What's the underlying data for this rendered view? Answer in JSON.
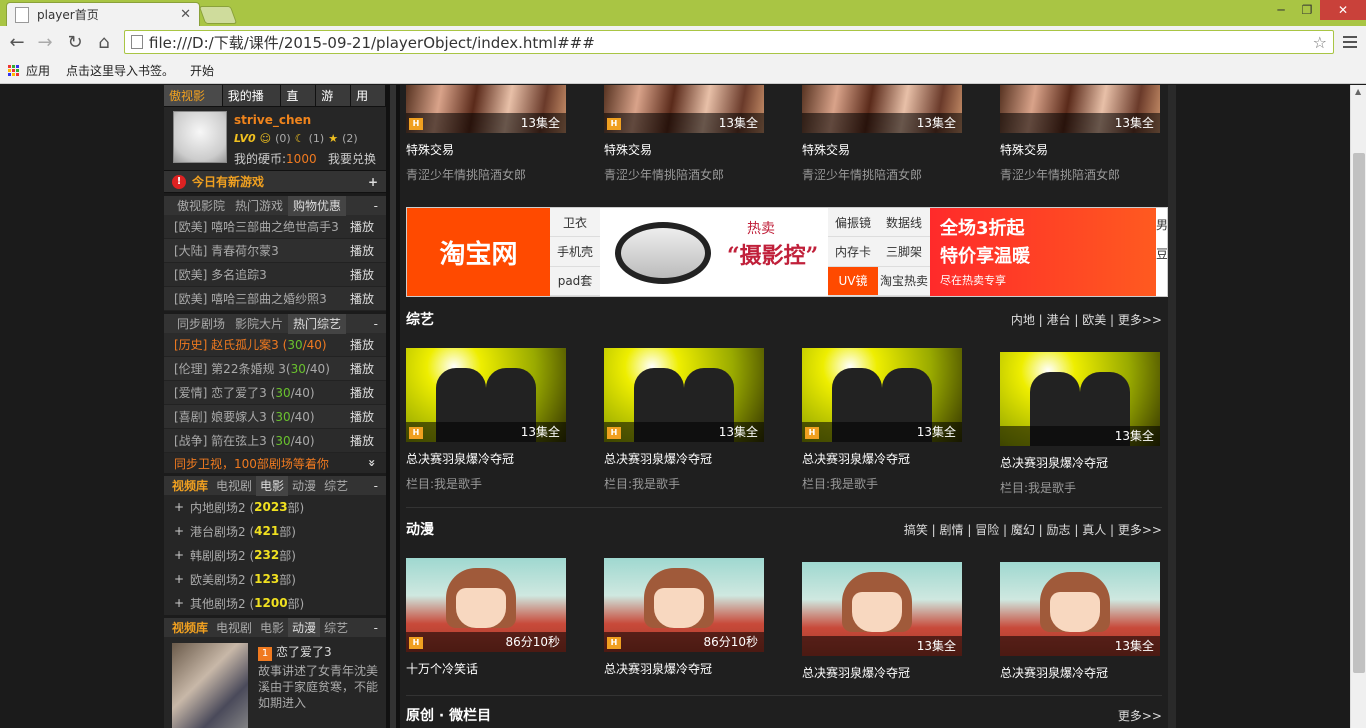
{
  "browser": {
    "tab_title": "player首页",
    "url": "file:///D:/下载/课件/2015-09-21/playerObject/index.html###",
    "bookmarks": [
      "应用",
      "点击这里导入书签。",
      "开始"
    ],
    "win_min": "─",
    "win_max": "❐",
    "win_close": "✕",
    "tab_close": "✕"
  },
  "sidebar": {
    "tabs": [
      "傲视影音",
      "我的播放",
      "直播",
      "游戏",
      "用户"
    ],
    "user": {
      "name": "strive_chen",
      "level": "LV0",
      "stat1": "(0)",
      "stat2": "(1)",
      "stat3": "(2)",
      "coin_label": "我的硬币:",
      "coin_value": "1000",
      "redeem": "我要兑换"
    },
    "newgame": {
      "label": "今日有新游戏",
      "plus": "+"
    },
    "section1": {
      "tabs": [
        "傲视影院",
        "热门游戏",
        "购物优惠"
      ],
      "minus": "-",
      "rows": [
        {
          "title": "[欧美] 嘻哈三部曲之绝世高手3",
          "play": "播放"
        },
        {
          "title": "[大陆] 青春荷尔蒙3",
          "play": "播放"
        },
        {
          "title": "[欧美] 多名追踪3",
          "play": "播放"
        },
        {
          "title": "[欧美] 嘻哈三部曲之婚纱照3",
          "play": "播放"
        }
      ]
    },
    "section2": {
      "tabs": [
        "同步剧场",
        "影院大片",
        "热门综艺"
      ],
      "minus": "-",
      "rows": [
        {
          "title": "[历史] 赵氏孤儿案3 (",
          "ep": "30",
          "total": "/40)",
          "play": "播放"
        },
        {
          "title": "[伦理] 第22条婚规 3(",
          "ep": "30",
          "total": "/40)",
          "play": "播放"
        },
        {
          "title": "[爱情] 恋了爱了3 (",
          "ep": "30",
          "total": "/40)",
          "play": "播放"
        },
        {
          "title": "[喜剧] 娘要嫁人3 (",
          "ep": "30",
          "total": "/40)",
          "play": "播放"
        },
        {
          "title": "[战争] 箭在弦上3 (",
          "ep": "30",
          "total": "/40)",
          "play": "播放"
        }
      ],
      "promo": "同步卫视，100部剧场等着你",
      "promo_icon": "»"
    },
    "library": {
      "tabs": [
        "视频库",
        "电视剧",
        "电影",
        "动漫",
        "综艺"
      ],
      "minus": "-",
      "items": [
        {
          "name": "内地剧场2 (",
          "count": "2023",
          "unit": "部)"
        },
        {
          "name": "港台剧场2 (",
          "count": "421",
          "unit": "部)"
        },
        {
          "name": "韩剧剧场2 (",
          "count": "232",
          "unit": "部)"
        },
        {
          "name": "欧美剧场2 (",
          "count": "123",
          "unit": "部)"
        },
        {
          "name": "其他剧场2 (",
          "count": "1200",
          "unit": "部)"
        }
      ]
    },
    "library2": {
      "tabs": [
        "视频库",
        "电视剧",
        "电影",
        "动漫",
        "综艺"
      ],
      "minus": "-",
      "feature": {
        "rank": "1",
        "title": "恋了爱了3",
        "text": "故事讲述了女青年沈美溪由于家庭贫寒，不能如期进入"
      }
    }
  },
  "main": {
    "tv_cards": [
      {
        "ep": "13集全",
        "title": "特殊交易",
        "sub": "青涩少年情挑陪酒女郎"
      },
      {
        "ep": "13集全",
        "title": "特殊交易",
        "sub": "青涩少年情挑陪酒女郎"
      },
      {
        "ep": "13集全",
        "title": "特殊交易",
        "sub": "青涩少年情挑陪酒女郎"
      },
      {
        "ep": "13集全",
        "title": "特殊交易",
        "sub": "青涩少年情挑陪酒女郎"
      }
    ],
    "banner": {
      "brand": "淘宝网",
      "col1": [
        "卫衣",
        "手机壳",
        "pad套"
      ],
      "hot_top": "热卖",
      "hot": "“摄影控”",
      "col2": [
        "偏振镜",
        "内存卡",
        "UV镜"
      ],
      "col3": [
        "数据线",
        "三脚架",
        "淘宝热卖"
      ],
      "sale1": "全场3折起",
      "sale2": "特价享温暖",
      "sale3": "尽在热卖专享",
      "edge": [
        "男",
        "豆"
      ]
    },
    "variety": {
      "title": "综艺",
      "links": "内地 | 港台 | 欧美 | 更多>>",
      "cards": [
        {
          "ep": "13集全",
          "title": "总决赛羽泉爆冷夺冠",
          "sub": "栏目:我是歌手"
        },
        {
          "ep": "13集全",
          "title": "总决赛羽泉爆冷夺冠",
          "sub": "栏目:我是歌手"
        },
        {
          "ep": "13集全",
          "title": "总决赛羽泉爆冷夺冠",
          "sub": "栏目:我是歌手"
        },
        {
          "ep": "13集全",
          "title": "总决赛羽泉爆冷夺冠",
          "sub": "栏目:我是歌手"
        }
      ]
    },
    "anime": {
      "title": "动漫",
      "links": "搞笑 | 剧情 | 冒险 | 魔幻 | 励志 | 真人 | 更多>>",
      "cards": [
        {
          "ep": "86分10秒",
          "title": "十万个冷笑话"
        },
        {
          "ep": "86分10秒",
          "title": "总决赛羽泉爆冷夺冠"
        },
        {
          "ep": "13集全",
          "title": "总决赛羽泉爆冷夺冠"
        },
        {
          "ep": "13集全",
          "title": "总决赛羽泉爆冷夺冠"
        }
      ]
    },
    "original": {
      "title": "原创 · 微栏目",
      "links": "更多>>"
    },
    "badge": "H"
  }
}
